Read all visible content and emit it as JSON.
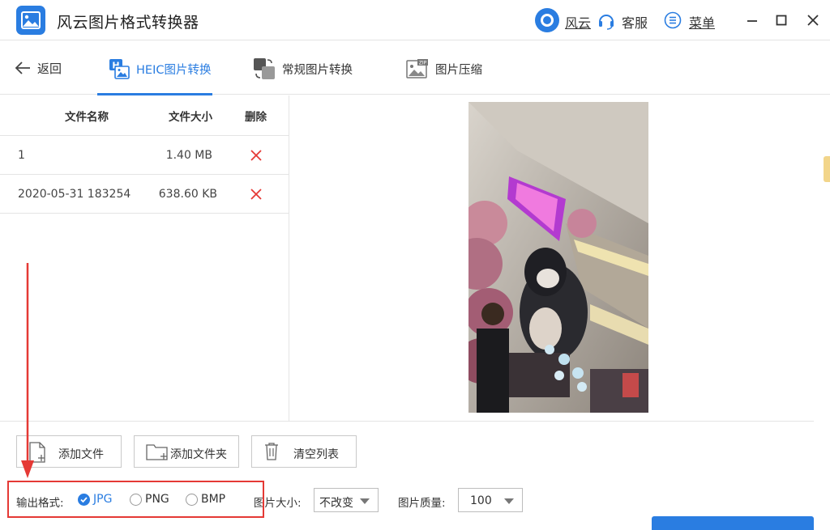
{
  "app": {
    "title": "风云图片格式转换器",
    "accent": "#2a7de1"
  },
  "titlebar": {
    "brand_label": "风云",
    "service_label": "客服",
    "menu_label": "菜单",
    "icons": [
      "fengyun-logo-icon",
      "headset-icon",
      "menu-list-icon",
      "minimize-icon",
      "maximize-icon",
      "close-icon"
    ]
  },
  "nav": {
    "back_label": "返回",
    "tabs": [
      {
        "label": "HEIC图片转换",
        "active": true,
        "icon": "heic-image-icon"
      },
      {
        "label": "常规图片转换",
        "active": false,
        "icon": "convert-image-icon"
      },
      {
        "label": "图片压缩",
        "active": false,
        "icon": "zip-image-icon"
      }
    ]
  },
  "file_table": {
    "headers": [
      "文件名称",
      "文件大小",
      "删除"
    ],
    "rows": [
      {
        "name": "1",
        "size": "1.40 MB"
      },
      {
        "name": "2020-05-31 183254",
        "size": "638.60 KB"
      }
    ]
  },
  "actions": {
    "add_file": "添加文件",
    "add_folder": "添加文件夹",
    "clear_list": "清空列表"
  },
  "output": {
    "format_label": "输出格式:",
    "formats": [
      {
        "label": "JPG",
        "checked": true
      },
      {
        "label": "PNG",
        "checked": false
      },
      {
        "label": "BMP",
        "checked": false
      }
    ],
    "size_label": "图片大小:",
    "size_value": "不改变",
    "quality_label": "图片质量:",
    "quality_value": "100"
  },
  "colors": {
    "highlight": "#e53935",
    "delete": "#e53935"
  }
}
